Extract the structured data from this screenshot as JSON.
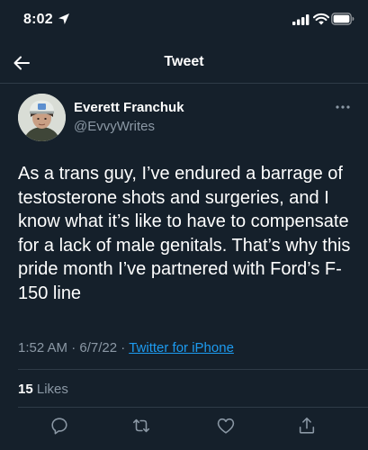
{
  "status_bar": {
    "time": "8:02"
  },
  "nav": {
    "title": "Tweet"
  },
  "tweet": {
    "author_name": "Everett Franchuk",
    "author_handle": "@EvvyWrites",
    "text": "As a trans guy, I’ve endured a barrage of testosterone shots and surgeries, and I know what it’s like to have to compensate for a lack of male genitals. That’s why this pride month I’ve partnered with Ford’s F-150 line",
    "time": "1:52 AM",
    "separator": "·",
    "date": "6/7/22",
    "source": "Twitter for iPhone",
    "likes_count": "15",
    "likes_label": "Likes"
  },
  "icons": {
    "back": "arrow-left-icon",
    "more": "more-horizontal-icon",
    "reply": "reply-icon",
    "retweet": "retweet-icon",
    "like": "heart-icon",
    "share": "share-icon"
  },
  "colors": {
    "background": "#15202b",
    "secondary_text": "#8b98a5",
    "link": "#1d9bf0",
    "divider": "#2f3b47"
  }
}
